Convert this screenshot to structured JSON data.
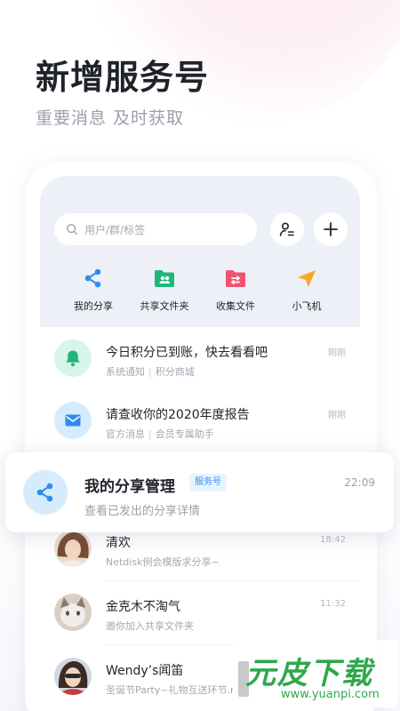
{
  "promo": {
    "headline": "新增服务号",
    "subline": "重要消息 及时获取"
  },
  "search": {
    "placeholder": "用户/群/标签"
  },
  "quick_actions": [
    {
      "label": "我的分享",
      "icon": "share-icon",
      "color": "#2f8cf0"
    },
    {
      "label": "共享文件夹",
      "icon": "shared-folder-icon",
      "color": "#20b67a"
    },
    {
      "label": "收集文件",
      "icon": "collect-folder-icon",
      "color": "#f2536e"
    },
    {
      "label": "小飞机",
      "icon": "paper-plane-icon",
      "color": "#f7a928"
    }
  ],
  "messages": [
    {
      "title": "今日积分已到账，快去看看吧",
      "source": "系统通知",
      "source2": "积分商城",
      "time": "刚刚",
      "icon": "bell-icon"
    },
    {
      "title": "请查收你的2020年度报告",
      "source": "官方消息",
      "source2": "会员专属助手",
      "time": "刚刚",
      "icon": "mail-icon"
    },
    {
      "title": "清欢",
      "sub": "Netdisk例会模版求分享~",
      "time": "18:42",
      "icon": "avatar"
    },
    {
      "title": "金克木不淘气",
      "sub": "邀你加入共享文件夹",
      "time": "11:32",
      "icon": "avatar"
    },
    {
      "title": "Wendy’s闻笛",
      "sub": "圣诞节Party~礼物互送环节.m",
      "time": "",
      "icon": "avatar"
    }
  ],
  "featured": {
    "title": "我的分享管理",
    "badge": "服务号",
    "sub": "查看已发出的分享详情",
    "time": "22:09"
  },
  "watermark": {
    "brand": "元皮下载",
    "url": "www.yuanpi.com"
  },
  "colors": {
    "accent_blue": "#2f8cf0",
    "badge_bg": "#e8f3fe",
    "watermark_green": "#2fa84a"
  }
}
